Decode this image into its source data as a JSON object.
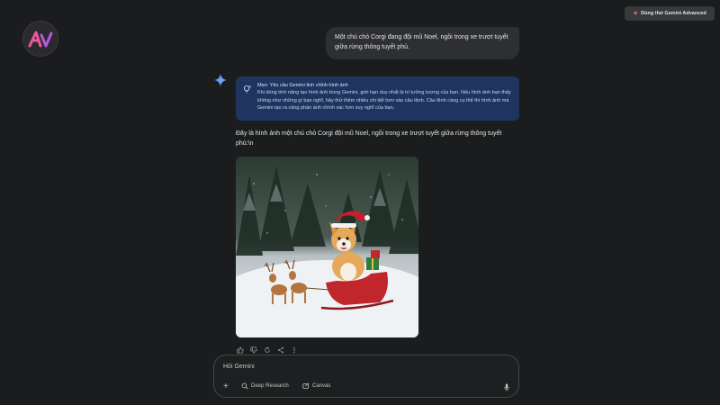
{
  "header": {
    "upgrade_label": "Dùng thử Gemini Advanced"
  },
  "chat": {
    "user_message": "Một chú chó Corgi đang đội mũ Noel, ngồi trong xe trượt tuyết giữa rừng thông tuyết phủ.",
    "tip": {
      "title": "Mẹo: Yêu cầu Gemini tinh chỉnh hình ảnh",
      "body": "Khi dùng tính năng tạo hình ảnh trong Gemini, giới hạn duy nhất là trí tưởng tượng của bạn. Nếu hình ảnh bạn thấy không như những gì bạn nghĩ, hãy thử thêm nhiều chi tiết hơn vào câu lệnh. Câu lệnh càng cụ thể thì hình ảnh mà Gemini tạo ra càng phản ánh chính xác hơn suy nghĩ của bạn."
    },
    "response_text": "Đây là hình ảnh một chú chó Corgi đội mũ Noel, ngồi trong xe trượt tuyết giữa rừng thông tuyết phủ:\\n"
  },
  "composer": {
    "placeholder": "Hỏi Gemini",
    "deep_research_label": "Deep Research",
    "canvas_label": "Canvas"
  },
  "colors": {
    "background": "#1b1c1d",
    "tip_card": "#1f3560",
    "user_bubble": "#2e2f31",
    "accent_star": "#4a8df6"
  }
}
